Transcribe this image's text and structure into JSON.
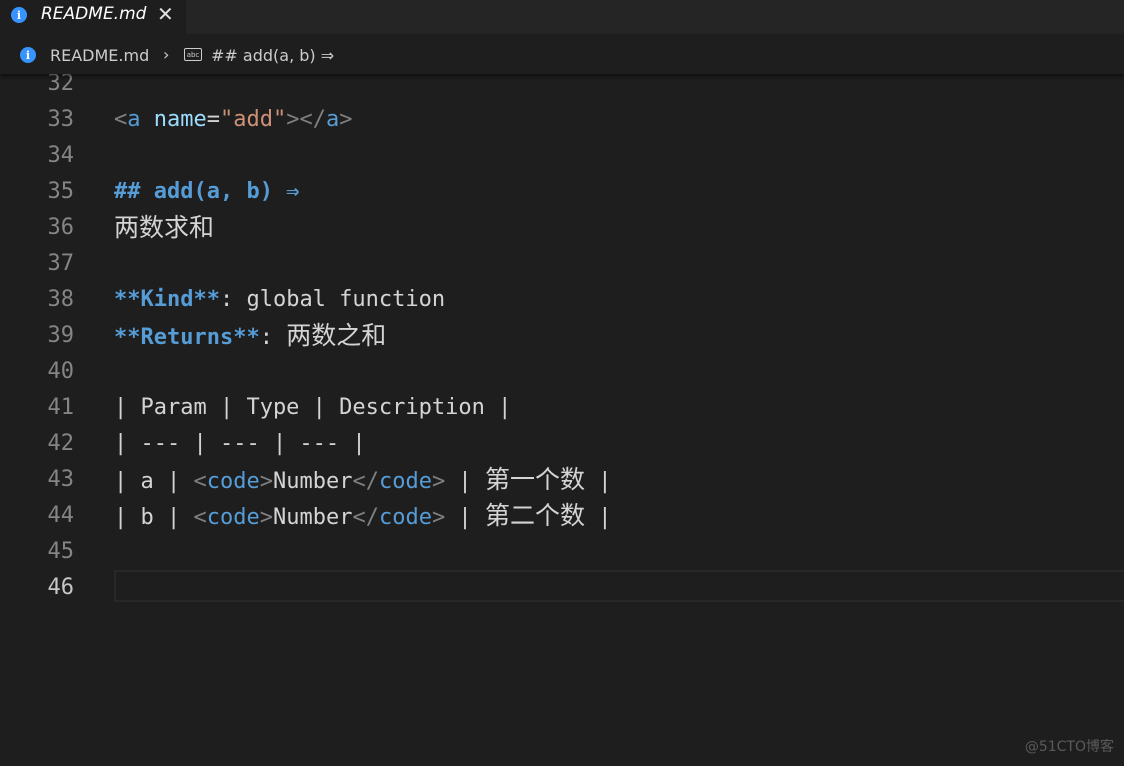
{
  "tab": {
    "label": "README.md",
    "close_glyph": "✕",
    "icon": "info-icon"
  },
  "breadcrumb": {
    "file": "README.md",
    "separator": "›",
    "symbol_icon_text": "abc",
    "symbol": "## add(a, b) ⇒"
  },
  "editor": {
    "active_line": "46",
    "lines": [
      {
        "n": "32",
        "segments": []
      },
      {
        "n": "33",
        "segments": [
          [
            "tag",
            "<"
          ],
          [
            "tagname",
            "a"
          ],
          [
            "plain",
            " "
          ],
          [
            "attr",
            "name"
          ],
          [
            "plain",
            "="
          ],
          [
            "str",
            "\"add\""
          ],
          [
            "tag",
            "></"
          ],
          [
            "tagname",
            "a"
          ],
          [
            "tag",
            ">"
          ]
        ]
      },
      {
        "n": "34",
        "segments": []
      },
      {
        "n": "35",
        "segments": [
          [
            "head",
            "## add(a, b) ⇒"
          ]
        ]
      },
      {
        "n": "36",
        "segments": [
          [
            "cjk",
            "两数求和"
          ]
        ]
      },
      {
        "n": "37",
        "segments": []
      },
      {
        "n": "38",
        "segments": [
          [
            "bold",
            "**Kind**"
          ],
          [
            "plain",
            ": global function"
          ]
        ]
      },
      {
        "n": "39",
        "segments": [
          [
            "bold",
            "**Returns**"
          ],
          [
            "plain",
            ": "
          ],
          [
            "cjk",
            "两数之和"
          ]
        ]
      },
      {
        "n": "40",
        "segments": []
      },
      {
        "n": "41",
        "segments": [
          [
            "plain",
            "| Param | Type | Description |"
          ]
        ]
      },
      {
        "n": "42",
        "segments": [
          [
            "plain",
            "| --- | --- | --- |"
          ]
        ]
      },
      {
        "n": "43",
        "segments": [
          [
            "plain",
            "| a | "
          ],
          [
            "tag",
            "<"
          ],
          [
            "tagname",
            "code"
          ],
          [
            "tag",
            ">"
          ],
          [
            "plain",
            "Number"
          ],
          [
            "tag",
            "</"
          ],
          [
            "tagname",
            "code"
          ],
          [
            "tag",
            ">"
          ],
          [
            "plain",
            " | "
          ],
          [
            "cjk",
            "第一个数"
          ],
          [
            "plain",
            " |"
          ]
        ]
      },
      {
        "n": "44",
        "segments": [
          [
            "plain",
            "| b | "
          ],
          [
            "tag",
            "<"
          ],
          [
            "tagname",
            "code"
          ],
          [
            "tag",
            ">"
          ],
          [
            "plain",
            "Number"
          ],
          [
            "tag",
            "</"
          ],
          [
            "tagname",
            "code"
          ],
          [
            "tag",
            ">"
          ],
          [
            "plain",
            " | "
          ],
          [
            "cjk",
            "第二个数"
          ],
          [
            "plain",
            " |"
          ]
        ]
      },
      {
        "n": "45",
        "segments": []
      },
      {
        "n": "46",
        "segments": []
      }
    ]
  },
  "colors": {
    "background": "#1e1e1e",
    "tag_bracket": "#808080",
    "tag_name": "#569cd6",
    "attribute": "#9cdcfe",
    "string": "#ce9178",
    "markdown_bold": "#569cd6",
    "text": "#d4d4d4"
  },
  "watermark": "@51CTO博客"
}
